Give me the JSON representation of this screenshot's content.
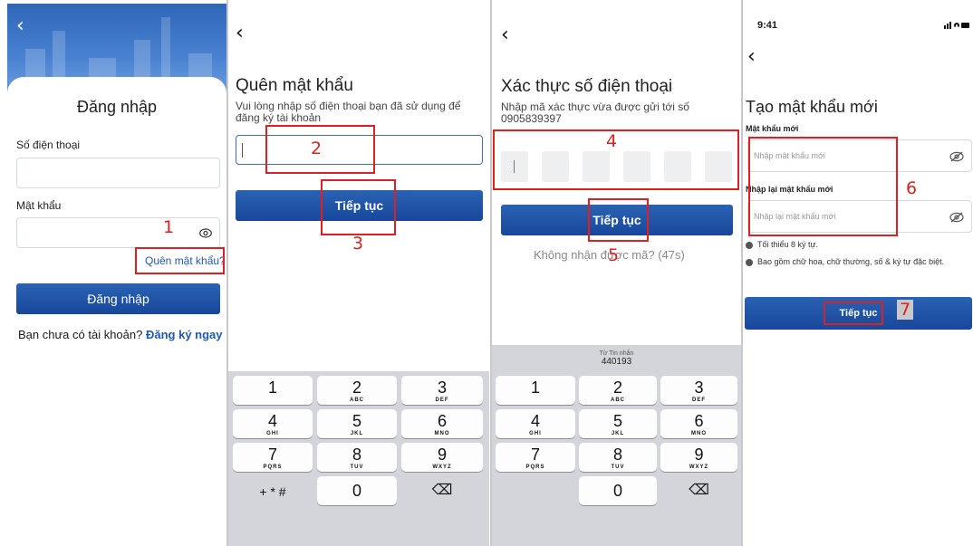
{
  "screen1": {
    "title": "Đăng nhập",
    "phone_label": "Số điện thoại",
    "password_label": "Mật khẩu",
    "forgot_link": "Quên mật khẩu?",
    "login_button": "Đăng nhập",
    "signup_prompt": "Bạn chưa có tài khoản?",
    "signup_link": "Đăng ký ngay"
  },
  "screen2": {
    "title": "Quên mật khẩu",
    "subtitle": "Vui lòng nhập số điện thoại bạn đã sử dụng để đăng ký tài khoản",
    "continue_button": "Tiếp tục"
  },
  "screen3": {
    "title": "Xác thực số điện thoại",
    "subtitle": "Nhập mã xác thực vừa được gửi tới số 0905839397",
    "continue_button": "Tiếp tục",
    "resend_text": "Không nhận được mã? (47s)",
    "suggestion_source": "Từ Tin nhắn",
    "suggestion_code": "440193"
  },
  "screen4": {
    "status_time": "9:41",
    "title": "Tạo mật khẩu mới",
    "new_password_label": "Mật khẩu mới",
    "new_password_placeholder": "Nhập mật khẩu mới",
    "confirm_password_label": "Nhập lại mật khẩu mới",
    "confirm_password_placeholder": "Nhập lại mật khẩu mới",
    "rule_1": "Tối thiểu 8 ký tự.",
    "rule_2": "Bao gồm chữ hoa, chữ thường, số & ký tự đặc biệt.",
    "continue_button": "Tiếp tục"
  },
  "keypad": [
    {
      "digit": "1",
      "letters": ""
    },
    {
      "digit": "2",
      "letters": "ABC"
    },
    {
      "digit": "3",
      "letters": "DEF"
    },
    {
      "digit": "4",
      "letters": "GHI"
    },
    {
      "digit": "5",
      "letters": "JKL"
    },
    {
      "digit": "6",
      "letters": "MNO"
    },
    {
      "digit": "7",
      "letters": "PQRS"
    },
    {
      "digit": "8",
      "letters": "TUV"
    },
    {
      "digit": "9",
      "letters": "WXYZ"
    },
    {
      "digit": "+ * #",
      "letters": ""
    },
    {
      "digit": "0",
      "letters": ""
    },
    {
      "digit": "⌫",
      "letters": ""
    }
  ],
  "annotations": [
    "1",
    "2",
    "3",
    "4",
    "5",
    "6",
    "7"
  ],
  "icons": {
    "back": "back-chevron-icon",
    "eye": "eye-icon",
    "eye_off": "eye-off-icon",
    "delete": "backspace-icon"
  },
  "colors": {
    "primary": "#1f58b5",
    "annotation": "#e02020"
  }
}
